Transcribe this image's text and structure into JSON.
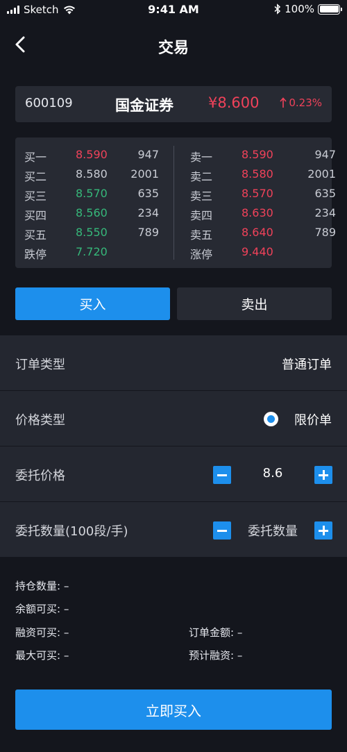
{
  "status_bar": {
    "carrier": "Sketch",
    "time": "9:41 AM",
    "battery": "100%"
  },
  "nav": {
    "title": "交易"
  },
  "quote": {
    "code": "600109",
    "name": "国金证券",
    "price": "¥8.600",
    "change": "0.23%"
  },
  "order_book": {
    "bids": [
      {
        "label": "买一",
        "price": "8.590",
        "volume": "947",
        "color": "#f0425a"
      },
      {
        "label": "买二",
        "price": "8.580",
        "volume": "2001",
        "color": "#c9ccd4"
      },
      {
        "label": "买三",
        "price": "8.570",
        "volume": "635",
        "color": "#36b87a"
      },
      {
        "label": "买四",
        "price": "8.560",
        "volume": "234",
        "color": "#36b87a"
      },
      {
        "label": "买五",
        "price": "8.550",
        "volume": "789",
        "color": "#36b87a"
      },
      {
        "label": "跌停",
        "price": "7.720",
        "volume": "",
        "color": "#36b87a"
      }
    ],
    "asks": [
      {
        "label": "卖一",
        "price": "8.590",
        "volume": "947",
        "color": "#f0425a"
      },
      {
        "label": "卖二",
        "price": "8.580",
        "volume": "2001",
        "color": "#f0425a"
      },
      {
        "label": "卖三",
        "price": "8.570",
        "volume": "635",
        "color": "#f0425a"
      },
      {
        "label": "卖四",
        "price": "8.630",
        "volume": "234",
        "color": "#f0425a"
      },
      {
        "label": "卖五",
        "price": "8.640",
        "volume": "789",
        "color": "#f0425a"
      },
      {
        "label": "涨停",
        "price": "9.440",
        "volume": "",
        "color": "#f0425a"
      }
    ]
  },
  "tabs": {
    "buy": "买入",
    "sell": "卖出"
  },
  "form": {
    "order_type_label": "订单类型",
    "order_type_value": "普通订单",
    "price_type_label": "价格类型",
    "price_type_value": "限价单",
    "entrust_price_label": "委托价格",
    "entrust_price_value": "8.6",
    "entrust_qty_label": "委托数量(100段/手)",
    "entrust_qty_placeholder": "委托数量"
  },
  "info": {
    "position_qty": "持仓数量: –",
    "balance_buyable": "余额可买: –",
    "margin_buyable": "融资可买: –",
    "order_amount": "订单金额: –",
    "max_buyable": "最大可买: –",
    "est_margin": "预计融资: –"
  },
  "submit": {
    "label": "立即买入"
  },
  "colors": {
    "accent": "#1d8fec",
    "up": "#f0425a",
    "down": "#36b87a",
    "background": "#14161d",
    "panel": "#272a33"
  }
}
